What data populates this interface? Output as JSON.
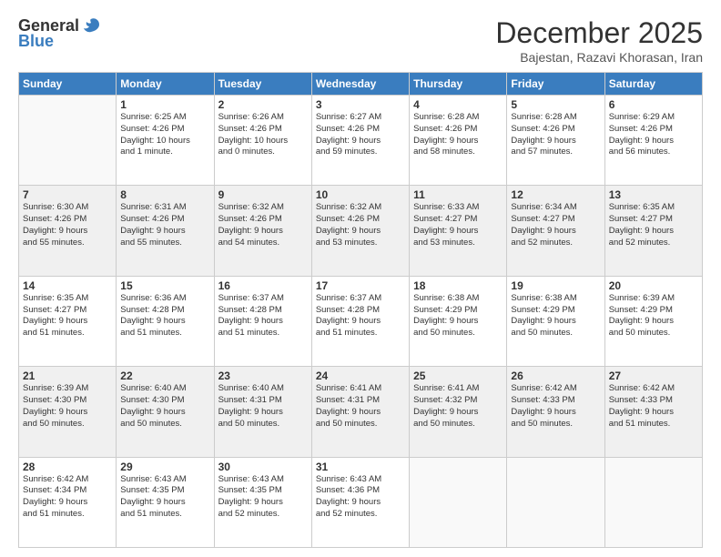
{
  "header": {
    "logo_general": "General",
    "logo_blue": "Blue",
    "month": "December 2025",
    "location": "Bajestan, Razavi Khorasan, Iran"
  },
  "days_of_week": [
    "Sunday",
    "Monday",
    "Tuesday",
    "Wednesday",
    "Thursday",
    "Friday",
    "Saturday"
  ],
  "weeks": [
    [
      {
        "day": "",
        "info": ""
      },
      {
        "day": "1",
        "info": "Sunrise: 6:25 AM\nSunset: 4:26 PM\nDaylight: 10 hours\nand 1 minute."
      },
      {
        "day": "2",
        "info": "Sunrise: 6:26 AM\nSunset: 4:26 PM\nDaylight: 10 hours\nand 0 minutes."
      },
      {
        "day": "3",
        "info": "Sunrise: 6:27 AM\nSunset: 4:26 PM\nDaylight: 9 hours\nand 59 minutes."
      },
      {
        "day": "4",
        "info": "Sunrise: 6:28 AM\nSunset: 4:26 PM\nDaylight: 9 hours\nand 58 minutes."
      },
      {
        "day": "5",
        "info": "Sunrise: 6:28 AM\nSunset: 4:26 PM\nDaylight: 9 hours\nand 57 minutes."
      },
      {
        "day": "6",
        "info": "Sunrise: 6:29 AM\nSunset: 4:26 PM\nDaylight: 9 hours\nand 56 minutes."
      }
    ],
    [
      {
        "day": "7",
        "info": "Sunrise: 6:30 AM\nSunset: 4:26 PM\nDaylight: 9 hours\nand 55 minutes."
      },
      {
        "day": "8",
        "info": "Sunrise: 6:31 AM\nSunset: 4:26 PM\nDaylight: 9 hours\nand 55 minutes."
      },
      {
        "day": "9",
        "info": "Sunrise: 6:32 AM\nSunset: 4:26 PM\nDaylight: 9 hours\nand 54 minutes."
      },
      {
        "day": "10",
        "info": "Sunrise: 6:32 AM\nSunset: 4:26 PM\nDaylight: 9 hours\nand 53 minutes."
      },
      {
        "day": "11",
        "info": "Sunrise: 6:33 AM\nSunset: 4:27 PM\nDaylight: 9 hours\nand 53 minutes."
      },
      {
        "day": "12",
        "info": "Sunrise: 6:34 AM\nSunset: 4:27 PM\nDaylight: 9 hours\nand 52 minutes."
      },
      {
        "day": "13",
        "info": "Sunrise: 6:35 AM\nSunset: 4:27 PM\nDaylight: 9 hours\nand 52 minutes."
      }
    ],
    [
      {
        "day": "14",
        "info": "Sunrise: 6:35 AM\nSunset: 4:27 PM\nDaylight: 9 hours\nand 51 minutes."
      },
      {
        "day": "15",
        "info": "Sunrise: 6:36 AM\nSunset: 4:28 PM\nDaylight: 9 hours\nand 51 minutes."
      },
      {
        "day": "16",
        "info": "Sunrise: 6:37 AM\nSunset: 4:28 PM\nDaylight: 9 hours\nand 51 minutes."
      },
      {
        "day": "17",
        "info": "Sunrise: 6:37 AM\nSunset: 4:28 PM\nDaylight: 9 hours\nand 51 minutes."
      },
      {
        "day": "18",
        "info": "Sunrise: 6:38 AM\nSunset: 4:29 PM\nDaylight: 9 hours\nand 50 minutes."
      },
      {
        "day": "19",
        "info": "Sunrise: 6:38 AM\nSunset: 4:29 PM\nDaylight: 9 hours\nand 50 minutes."
      },
      {
        "day": "20",
        "info": "Sunrise: 6:39 AM\nSunset: 4:29 PM\nDaylight: 9 hours\nand 50 minutes."
      }
    ],
    [
      {
        "day": "21",
        "info": "Sunrise: 6:39 AM\nSunset: 4:30 PM\nDaylight: 9 hours\nand 50 minutes."
      },
      {
        "day": "22",
        "info": "Sunrise: 6:40 AM\nSunset: 4:30 PM\nDaylight: 9 hours\nand 50 minutes."
      },
      {
        "day": "23",
        "info": "Sunrise: 6:40 AM\nSunset: 4:31 PM\nDaylight: 9 hours\nand 50 minutes."
      },
      {
        "day": "24",
        "info": "Sunrise: 6:41 AM\nSunset: 4:31 PM\nDaylight: 9 hours\nand 50 minutes."
      },
      {
        "day": "25",
        "info": "Sunrise: 6:41 AM\nSunset: 4:32 PM\nDaylight: 9 hours\nand 50 minutes."
      },
      {
        "day": "26",
        "info": "Sunrise: 6:42 AM\nSunset: 4:33 PM\nDaylight: 9 hours\nand 50 minutes."
      },
      {
        "day": "27",
        "info": "Sunrise: 6:42 AM\nSunset: 4:33 PM\nDaylight: 9 hours\nand 51 minutes."
      }
    ],
    [
      {
        "day": "28",
        "info": "Sunrise: 6:42 AM\nSunset: 4:34 PM\nDaylight: 9 hours\nand 51 minutes."
      },
      {
        "day": "29",
        "info": "Sunrise: 6:43 AM\nSunset: 4:35 PM\nDaylight: 9 hours\nand 51 minutes."
      },
      {
        "day": "30",
        "info": "Sunrise: 6:43 AM\nSunset: 4:35 PM\nDaylight: 9 hours\nand 52 minutes."
      },
      {
        "day": "31",
        "info": "Sunrise: 6:43 AM\nSunset: 4:36 PM\nDaylight: 9 hours\nand 52 minutes."
      },
      {
        "day": "",
        "info": ""
      },
      {
        "day": "",
        "info": ""
      },
      {
        "day": "",
        "info": ""
      }
    ]
  ]
}
